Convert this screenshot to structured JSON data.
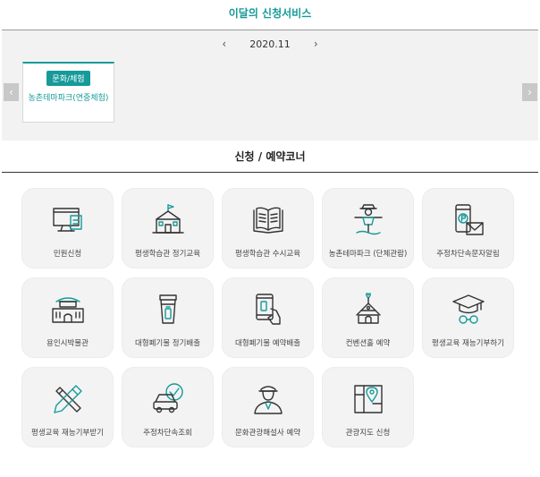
{
  "header": {
    "title": "이달의 신청서비스"
  },
  "monthly": {
    "prev_arrow": "‹",
    "month": "2020.11",
    "next_arrow": "›",
    "side_prev": "‹",
    "side_next": "›",
    "cards": [
      {
        "badge": "문화/체험",
        "title": "농촌테마파크(연중체험)"
      }
    ]
  },
  "section": {
    "title": "신청 / 예약코너"
  },
  "services": [
    {
      "label": "민원신청",
      "icon": "monitor-document-icon"
    },
    {
      "label": "평생학습관 정기교육",
      "icon": "school-building-icon"
    },
    {
      "label": "평생학습관 수시교육",
      "icon": "open-book-icon"
    },
    {
      "label": "농촌테마파크 (단체관람)",
      "icon": "scarecrow-icon"
    },
    {
      "label": "주정차단속문자알림",
      "icon": "phone-parking-mail-icon"
    },
    {
      "label": "용인시박물관",
      "icon": "museum-gate-icon"
    },
    {
      "label": "대형폐기물 정기배출",
      "icon": "waste-bin-icon"
    },
    {
      "label": "대형폐기물 예약배출",
      "icon": "phone-hand-icon"
    },
    {
      "label": "컨벤션홀 예약",
      "icon": "wedding-chapel-icon"
    },
    {
      "label": "평생교육 재능기부하기",
      "icon": "graduation-cap-icon"
    },
    {
      "label": "평생교육 재능기부받기",
      "icon": "tools-icon"
    },
    {
      "label": "주정차단속조회",
      "icon": "car-check-icon"
    },
    {
      "label": "문화관광해설사 예약",
      "icon": "guide-person-icon"
    },
    {
      "label": "관광지도 신청",
      "icon": "map-icon"
    }
  ]
}
